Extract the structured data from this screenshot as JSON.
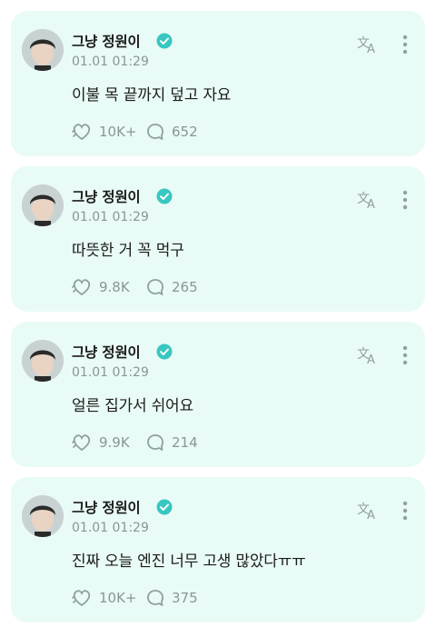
{
  "posts": [
    {
      "author": "그냥 정원이",
      "time": "01.01 01:29",
      "text": "이불 목 끝까지 덮고 자요",
      "likes": "10K+",
      "comments": "652"
    },
    {
      "author": "그냥 정원이",
      "time": "01.01 01:29",
      "text": "따뜻한 거 꼭 먹구",
      "likes": "9.8K",
      "comments": "265"
    },
    {
      "author": "그냥 정원이",
      "time": "01.01 01:29",
      "text": "얼른 집가서 쉬어요",
      "likes": "9.9K",
      "comments": "214"
    },
    {
      "author": "그냥 정원이",
      "time": "01.01 01:29",
      "text": "진짜 오늘 엔진 너무 고생 많았다ㅠㅠ",
      "likes": "10K+",
      "comments": "375"
    }
  ],
  "colors": {
    "card_bg": "#e9fbf6",
    "verified": "#38c7c0",
    "muted": "#8a9696"
  },
  "icons": [
    "avatar",
    "verified-badge-icon",
    "translate-icon",
    "more-vertical-icon",
    "heart-icon",
    "comment-icon"
  ]
}
